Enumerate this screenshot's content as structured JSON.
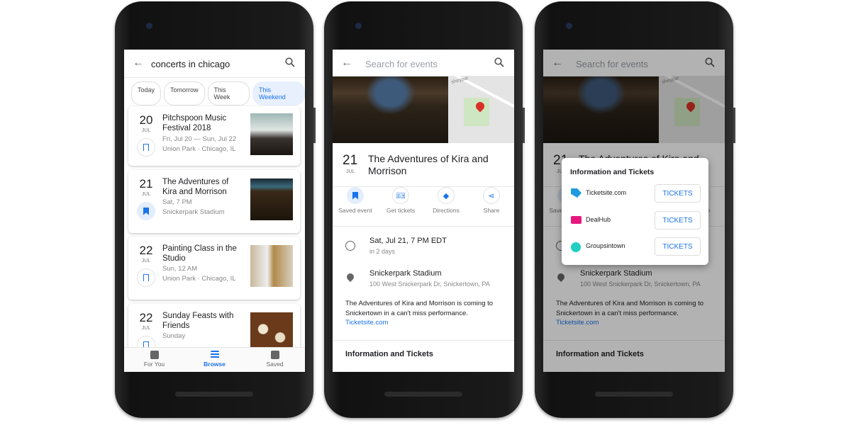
{
  "browse": {
    "query": "concerts in chicago",
    "chips": [
      "Today",
      "Tomorrow",
      "This Week",
      "This Weekend"
    ],
    "selected_chip": "This Weekend",
    "events": [
      {
        "day": "20",
        "month": "JUL",
        "title": "Pitchspoon Music Festival 2018",
        "when": "Fri, Jul 20 — Sun, Jul 22",
        "where": "Union Park · Chicago, IL",
        "saved": false
      },
      {
        "day": "21",
        "month": "JUL",
        "title": "The Adventures of Kira and Morrison",
        "when": "Sat, 7 PM",
        "where": "Snickerpark Stadium",
        "saved": true
      },
      {
        "day": "22",
        "month": "JUL",
        "title": "Painting Class in the Studio",
        "when": "Sun, 12 AM",
        "where": "Union Park · Chicago, IL",
        "saved": false
      },
      {
        "day": "22",
        "month": "JUL",
        "title": "Sunday Feasts with Friends",
        "when": "Sunday",
        "where": "",
        "saved": false
      }
    ],
    "nav": [
      "For You",
      "Browse",
      "Saved"
    ],
    "active_nav": "Browse"
  },
  "detail": {
    "search_placeholder": "Search for events",
    "map_label": "sheypar",
    "day": "21",
    "month": "JUL",
    "title": "The Adventures of Kira and Morrison",
    "actions": [
      "Saved event",
      "Get tickets",
      "Directions",
      "Share"
    ],
    "datetime": "Sat, Jul 21, 7 PM EDT",
    "relative": "in 2 days",
    "venue": "Snickerpark Stadium",
    "address": "100 West Snickerpark Dr, Snickertown, PA",
    "description": "The Adventures of Kira and Morrison is coming to Snickertown in a can't miss performance.",
    "link": "Ticketsite.com",
    "section": "Information and Tickets"
  },
  "dialog": {
    "title": "Information and Tickets",
    "providers": [
      {
        "name": "Ticketsite.com",
        "button": "TICKETS",
        "icon": "tag-icon",
        "color": "#1e9be0"
      },
      {
        "name": "DealHub",
        "button": "TICKETS",
        "icon": "ticket-icon",
        "color": "#e8177f"
      },
      {
        "name": "Groupsintown",
        "button": "TICKETS",
        "icon": "music-note-icon",
        "color": "#1fcfc1"
      }
    ]
  },
  "colors": {
    "accent": "#1a73e8"
  }
}
